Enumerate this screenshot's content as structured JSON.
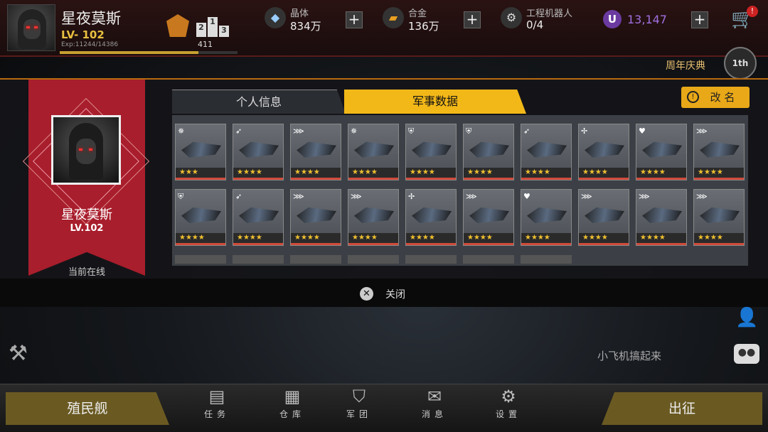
{
  "player": {
    "name": "星夜莫斯",
    "level": "LV- 102",
    "exp": "Exp:11244/14386",
    "exp_fraction": 0.78,
    "rank": "411",
    "podium": [
      "2",
      "1",
      "3"
    ]
  },
  "resources": [
    {
      "icon": "crystal-icon",
      "label": "晶体",
      "value": "834万"
    },
    {
      "icon": "alloy-icon",
      "label": "合金",
      "value": "136万"
    },
    {
      "icon": "robot-icon",
      "label": "工程机器人",
      "value": "0/4"
    }
  ],
  "currency": {
    "icon_letter": "U",
    "value": "13,147"
  },
  "cart": {
    "badge": "!"
  },
  "anniversary": {
    "label": "周年庆典",
    "icon_text": "1th"
  },
  "profile": {
    "name": "星夜莫斯",
    "level": "LV.102",
    "status": "当前在线"
  },
  "tabs": [
    {
      "label": "个人信息",
      "active": false
    },
    {
      "label": "军事数据",
      "active": true
    }
  ],
  "rename_label": "改 名",
  "ships": [
    {
      "cls": "✵",
      "stars": "★★★"
    },
    {
      "cls": "➶",
      "stars": "★★★★"
    },
    {
      "cls": "⋙",
      "stars": "★★★★"
    },
    {
      "cls": "✵",
      "stars": "★★★★"
    },
    {
      "cls": "⛨",
      "stars": "★★★★"
    },
    {
      "cls": "⛨",
      "stars": "★★★★"
    },
    {
      "cls": "➶",
      "stars": "★★★★"
    },
    {
      "cls": "✢",
      "stars": "★★★★"
    },
    {
      "cls": "♥",
      "stars": "★★★★"
    },
    {
      "cls": "⋙",
      "stars": "★★★★"
    },
    {
      "cls": "⛨",
      "stars": "★★★★"
    },
    {
      "cls": "➶",
      "stars": "★★★★"
    },
    {
      "cls": "⋙",
      "stars": "★★★★"
    },
    {
      "cls": "⋙",
      "stars": "★★★★"
    },
    {
      "cls": "✢",
      "stars": "★★★★"
    },
    {
      "cls": "⋙",
      "stars": "★★★★"
    },
    {
      "cls": "♥",
      "stars": "★★★★"
    },
    {
      "cls": "⋙",
      "stars": "★★★★"
    },
    {
      "cls": "⋙",
      "stars": "★★★★"
    },
    {
      "cls": "⋙",
      "stars": "★★★★"
    }
  ],
  "empty_slots": 7,
  "close_label": "关闭",
  "chat": {
    "message": "小飞机搞起来",
    "button": "●●"
  },
  "bottom": {
    "colony": "殖民舰",
    "sortie": "出征",
    "nav": [
      {
        "label": "任务",
        "icon": "mission-icon",
        "glyph": "▤"
      },
      {
        "label": "仓库",
        "icon": "warehouse-icon",
        "glyph": "▦"
      },
      {
        "label": "军团",
        "icon": "legion-icon",
        "glyph": "⛉"
      },
      {
        "label": "消息",
        "icon": "message-icon",
        "glyph": "✉"
      },
      {
        "label": "设置",
        "icon": "settings-icon",
        "glyph": "⚙"
      }
    ]
  }
}
